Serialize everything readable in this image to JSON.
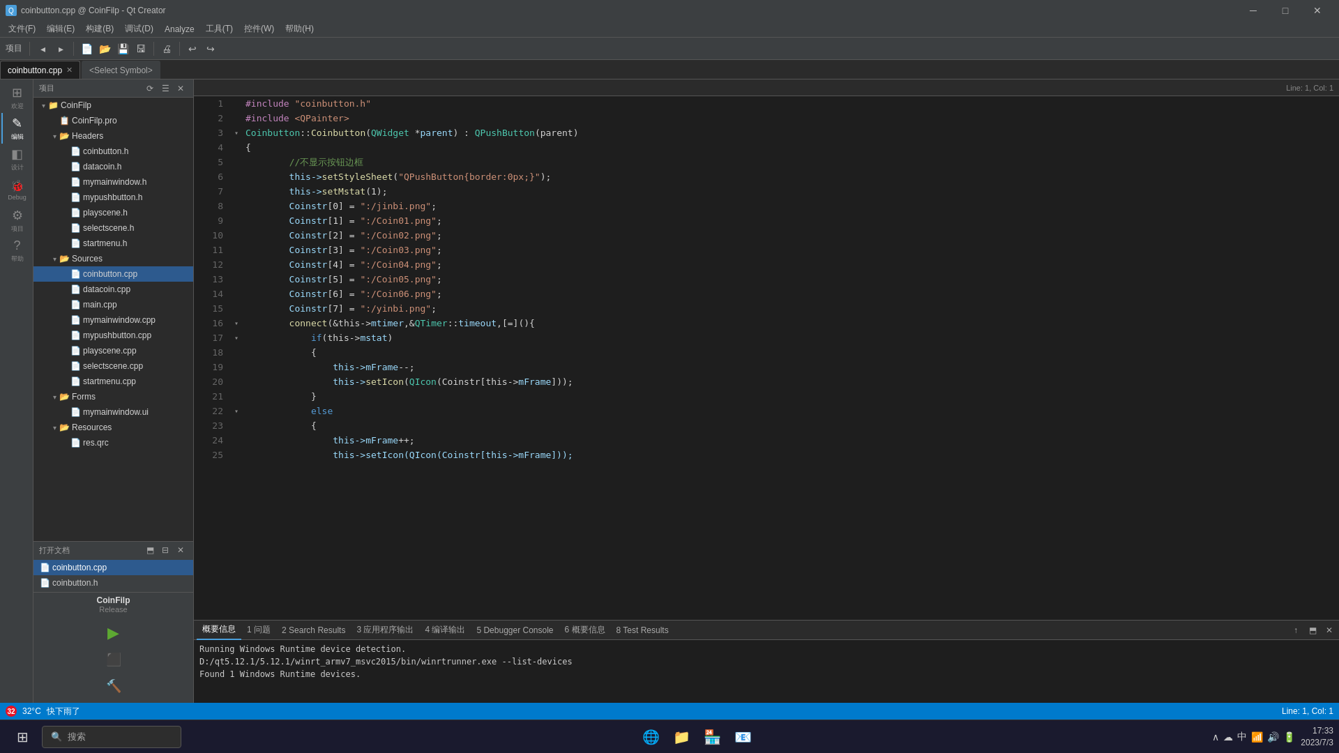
{
  "titlebar": {
    "title": "coinbutton.cpp @ CoinFilp - Qt Creator",
    "icon": "Q"
  },
  "menubar": {
    "items": [
      "文件(F)",
      "编辑(E)",
      "构建(B)",
      "调试(D)",
      "Analyze",
      "工具(T)",
      "控件(W)",
      "帮助(H)"
    ]
  },
  "toolbar": {
    "project_label": "项目"
  },
  "tabs": {
    "active": "coinbutton.cpp",
    "items": [
      "coinbutton.cpp",
      "<Select Symbol>"
    ]
  },
  "editor": {
    "status": "Line: 1, Col: 1",
    "lines": [
      {
        "num": 1,
        "fold": "",
        "content_parts": [
          {
            "text": "#include ",
            "cls": "preproc"
          },
          {
            "text": "\"coinbutton.h\"",
            "cls": "str"
          }
        ]
      },
      {
        "num": 2,
        "fold": "",
        "content_parts": [
          {
            "text": "#include ",
            "cls": "preproc"
          },
          {
            "text": "<QPainter>",
            "cls": "preproc-val"
          }
        ]
      },
      {
        "num": 3,
        "fold": "open",
        "content_parts": [
          {
            "text": "Coinbutton",
            "cls": "cls"
          },
          {
            "text": "::",
            "cls": "op"
          },
          {
            "text": "Coinbutton",
            "cls": "fn"
          },
          {
            "text": "(",
            "cls": "punc"
          },
          {
            "text": "QWidget",
            "cls": "cls"
          },
          {
            "text": " *",
            "cls": "op"
          },
          {
            "text": "parent",
            "cls": "var"
          },
          {
            "text": ") : ",
            "cls": "punc"
          },
          {
            "text": "QPushButton",
            "cls": "cls"
          },
          {
            "text": "(parent)",
            "cls": "punc"
          }
        ]
      },
      {
        "num": 4,
        "fold": "",
        "content_parts": [
          {
            "text": "{",
            "cls": "punc"
          }
        ]
      },
      {
        "num": 5,
        "fold": "",
        "content_parts": [
          {
            "text": "        ",
            "cls": ""
          },
          {
            "text": "//不显示按钮边框",
            "cls": "zh-cmt"
          }
        ]
      },
      {
        "num": 6,
        "fold": "",
        "content_parts": [
          {
            "text": "        this->",
            "cls": "var"
          },
          {
            "text": "setStyleSheet",
            "cls": "fn"
          },
          {
            "text": "(",
            "cls": "punc"
          },
          {
            "text": "\"QPushButton{border:0px;}\"",
            "cls": "str"
          },
          {
            "text": ");",
            "cls": "punc"
          }
        ]
      },
      {
        "num": 7,
        "fold": "",
        "content_parts": [
          {
            "text": "        this->",
            "cls": "var"
          },
          {
            "text": "setMstat",
            "cls": "fn"
          },
          {
            "text": "(1);",
            "cls": "punc"
          }
        ]
      },
      {
        "num": 8,
        "fold": "",
        "content_parts": [
          {
            "text": "        Coinstr",
            "cls": "var"
          },
          {
            "text": "[0] = ",
            "cls": "op"
          },
          {
            "text": "\":/jinbi.png\"",
            "cls": "str"
          },
          {
            "text": ";",
            "cls": "punc"
          }
        ]
      },
      {
        "num": 9,
        "fold": "",
        "content_parts": [
          {
            "text": "        Coinstr",
            "cls": "var"
          },
          {
            "text": "[1] = ",
            "cls": "op"
          },
          {
            "text": "\":/Coin01.png\"",
            "cls": "str"
          },
          {
            "text": ";",
            "cls": "punc"
          }
        ]
      },
      {
        "num": 10,
        "fold": "",
        "content_parts": [
          {
            "text": "        Coinstr",
            "cls": "var"
          },
          {
            "text": "[2] = ",
            "cls": "op"
          },
          {
            "text": "\":/Coin02.png\"",
            "cls": "str"
          },
          {
            "text": ";",
            "cls": "punc"
          }
        ]
      },
      {
        "num": 11,
        "fold": "",
        "content_parts": [
          {
            "text": "        Coinstr",
            "cls": "var"
          },
          {
            "text": "[3] = ",
            "cls": "op"
          },
          {
            "text": "\":/Coin03.png\"",
            "cls": "str"
          },
          {
            "text": ";",
            "cls": "punc"
          }
        ]
      },
      {
        "num": 12,
        "fold": "",
        "content_parts": [
          {
            "text": "        Coinstr",
            "cls": "var"
          },
          {
            "text": "[4] = ",
            "cls": "op"
          },
          {
            "text": "\":/Coin04.png\"",
            "cls": "str"
          },
          {
            "text": ";",
            "cls": "punc"
          }
        ]
      },
      {
        "num": 13,
        "fold": "",
        "content_parts": [
          {
            "text": "        Coinstr",
            "cls": "var"
          },
          {
            "text": "[5] = ",
            "cls": "op"
          },
          {
            "text": "\":/Coin05.png\"",
            "cls": "str"
          },
          {
            "text": ";",
            "cls": "punc"
          }
        ]
      },
      {
        "num": 14,
        "fold": "",
        "content_parts": [
          {
            "text": "        Coinstr",
            "cls": "var"
          },
          {
            "text": "[6] = ",
            "cls": "op"
          },
          {
            "text": "\":/Coin06.png\"",
            "cls": "str"
          },
          {
            "text": ";",
            "cls": "punc"
          }
        ]
      },
      {
        "num": 15,
        "fold": "",
        "content_parts": [
          {
            "text": "        Coinstr",
            "cls": "var"
          },
          {
            "text": "[7] = ",
            "cls": "op"
          },
          {
            "text": "\":/yinbi.png\"",
            "cls": "str"
          },
          {
            "text": ";",
            "cls": "punc"
          }
        ]
      },
      {
        "num": 16,
        "fold": "open",
        "content_parts": [
          {
            "text": "        connect",
            "cls": "fn"
          },
          {
            "text": "(&this->",
            "cls": "op"
          },
          {
            "text": "mtimer",
            "cls": "var"
          },
          {
            "text": ",&",
            "cls": "op"
          },
          {
            "text": "QTimer",
            "cls": "cls"
          },
          {
            "text": "::",
            "cls": "op"
          },
          {
            "text": "timeout",
            "cls": "var"
          },
          {
            "text": ",[=](){",
            "cls": "punc"
          }
        ]
      },
      {
        "num": 17,
        "fold": "open",
        "content_parts": [
          {
            "text": "            if",
            "cls": "kw"
          },
          {
            "text": "(this->",
            "cls": "op"
          },
          {
            "text": "mstat",
            "cls": "var"
          },
          {
            "text": ")",
            "cls": "punc"
          }
        ]
      },
      {
        "num": 18,
        "fold": "",
        "content_parts": [
          {
            "text": "            {",
            "cls": "punc"
          }
        ]
      },
      {
        "num": 19,
        "fold": "",
        "content_parts": [
          {
            "text": "                this->",
            "cls": "var"
          },
          {
            "text": "mFrame",
            "cls": "var"
          },
          {
            "text": "--;",
            "cls": "op"
          }
        ]
      },
      {
        "num": 20,
        "fold": "",
        "content_parts": [
          {
            "text": "                this->",
            "cls": "var"
          },
          {
            "text": "setIcon",
            "cls": "fn"
          },
          {
            "text": "(",
            "cls": "punc"
          },
          {
            "text": "QIcon",
            "cls": "cls"
          },
          {
            "text": "(Coinstr[this->",
            "cls": "punc"
          },
          {
            "text": "mFrame",
            "cls": "var"
          },
          {
            "text": "]));",
            "cls": "punc"
          }
        ]
      },
      {
        "num": 21,
        "fold": "",
        "content_parts": [
          {
            "text": "            }",
            "cls": "punc"
          }
        ]
      },
      {
        "num": 22,
        "fold": "open",
        "content_parts": [
          {
            "text": "            else",
            "cls": "kw"
          }
        ]
      },
      {
        "num": 23,
        "fold": "",
        "content_parts": [
          {
            "text": "            {",
            "cls": "punc"
          }
        ]
      },
      {
        "num": 24,
        "fold": "",
        "content_parts": [
          {
            "text": "                this->",
            "cls": "var"
          },
          {
            "text": "mFrame",
            "cls": "var"
          },
          {
            "text": "++;",
            "cls": "op"
          }
        ]
      },
      {
        "num": 25,
        "fold": "",
        "content_parts": [
          {
            "text": "                this->setIcon(QIcon(Coinstr[this->mFrame]));",
            "cls": "var"
          }
        ]
      }
    ]
  },
  "sidebar_icons": [
    {
      "label": "欢迎",
      "icon": "⊞",
      "active": false
    },
    {
      "label": "编辑",
      "icon": "✎",
      "active": true
    },
    {
      "label": "设计",
      "icon": "◧",
      "active": false
    },
    {
      "label": "Debug",
      "icon": "🐞",
      "active": false
    },
    {
      "label": "项目",
      "icon": "⚙",
      "active": false
    },
    {
      "label": "帮助",
      "icon": "?",
      "active": false
    }
  ],
  "project_panel": {
    "title": "项目",
    "root": "CoinFilp",
    "tree": {
      "coinfilp_pro": "CoinFilp.pro",
      "headers_label": "Headers",
      "headers": [
        "coinbutton.h",
        "datacoin.h",
        "mymainwindow.h",
        "mypushbutton.h",
        "playscene.h",
        "selectscene.h",
        "startmenu.h"
      ],
      "sources_label": "Sources",
      "sources": [
        "coinbutton.cpp",
        "datacoin.cpp",
        "main.cpp",
        "mymainwindow.cpp",
        "mypushbutton.cpp",
        "playscene.cpp",
        "selectscene.cpp",
        "startmenu.cpp"
      ],
      "forms_label": "Forms",
      "forms": [
        "mymainwindow.ui"
      ],
      "resources_label": "Resources",
      "resources": [
        "res.qrc"
      ]
    }
  },
  "open_docs": {
    "label": "打开文档",
    "items": [
      "coinbutton.cpp",
      "coinbutton.h"
    ]
  },
  "kit": {
    "name": "CoinFilp",
    "config": "Release"
  },
  "output_panel": {
    "tabs": [
      "概要信息",
      "1 问题",
      "2 Search Results",
      "3 应用程序输出",
      "4 编译输出",
      "5 Debugger Console",
      "6 概要信息",
      "8 Test Results"
    ],
    "active_tab": "概要信息",
    "content": [
      "Running Windows Runtime device detection.",
      "D:/qt5.12.1/5.12.1/winrt_armv7_msvc2015/bin/winrtrunner.exe --list-devices",
      "Found 1 Windows Runtime devices."
    ]
  },
  "statusbar": {
    "error_count": "32",
    "temp": "32°C",
    "weather": "快下雨了",
    "position": "Line: 1, Col: 1"
  },
  "taskbar": {
    "search_placeholder": "搜索",
    "time": "17:33",
    "date": "2023/7/3"
  }
}
